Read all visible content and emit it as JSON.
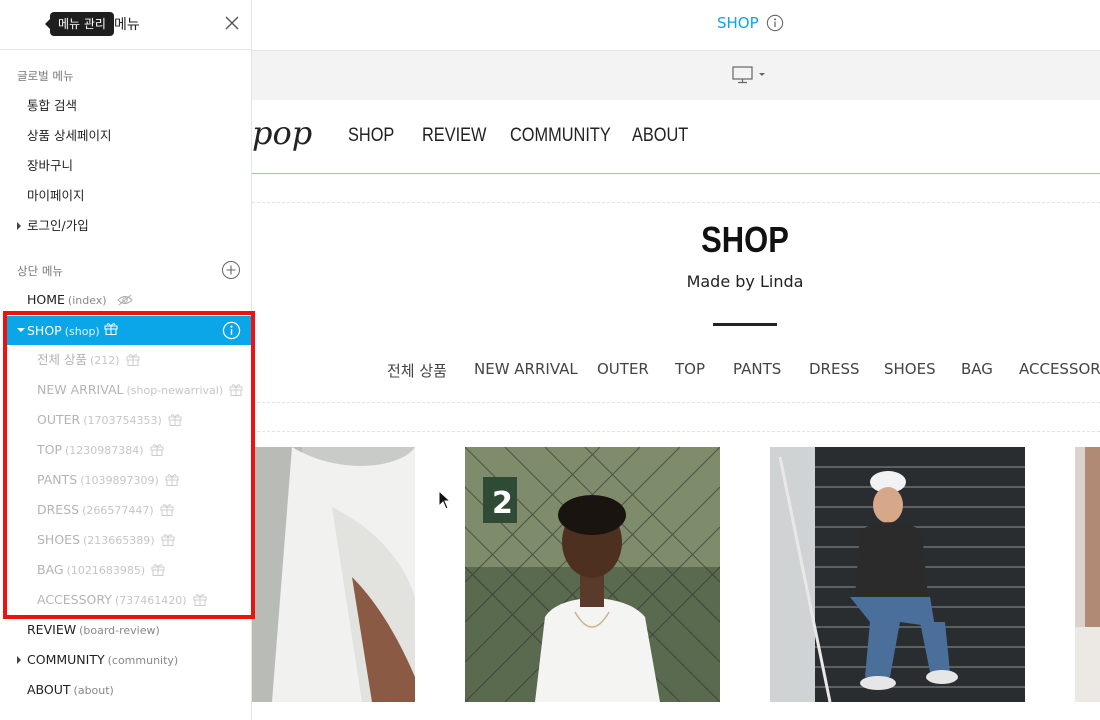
{
  "sidebar": {
    "tooltip": "메뉴 관리",
    "title": "메뉴",
    "global_label": "글로벌 메뉴",
    "global_items": [
      "통합 검색",
      "상품 상세페이지",
      "장바구니",
      "마이페이지",
      "로그인/가입"
    ],
    "top_label": "상단 메뉴",
    "home": {
      "label": "HOME",
      "slug": "(index)"
    },
    "shop": {
      "label": "SHOP",
      "slug": "(shop)"
    },
    "shop_children": [
      {
        "label": "전체 상품",
        "slug": "(212)"
      },
      {
        "label": "NEW ARRIVAL",
        "slug": "(shop-newarrival)"
      },
      {
        "label": "OUTER",
        "slug": "(1703754353)"
      },
      {
        "label": "TOP",
        "slug": "(1230987384)"
      },
      {
        "label": "PANTS",
        "slug": "(1039897309)"
      },
      {
        "label": "DRESS",
        "slug": "(266577447)"
      },
      {
        "label": "SHOES",
        "slug": "(213665389)"
      },
      {
        "label": "BAG",
        "slug": "(1021683985)"
      },
      {
        "label": "ACCESSORY",
        "slug": "(737461420)"
      }
    ],
    "review": {
      "label": "REVIEW",
      "slug": "(board-review)"
    },
    "community": {
      "label": "COMMUNITY",
      "slug": "(community)"
    },
    "about": {
      "label": "ABOUT",
      "slug": "(about)"
    }
  },
  "topbar": {
    "title": "SHOP"
  },
  "site": {
    "logo": "pop",
    "nav": [
      "SHOP",
      "REVIEW",
      "COMMUNITY",
      "ABOUT"
    ]
  },
  "page": {
    "heading": "SHOP",
    "subtitle": "Made by Linda",
    "categories": [
      "전체 상품",
      "NEW ARRIVAL",
      "OUTER",
      "TOP",
      "PANTS",
      "DRESS",
      "SHOES",
      "BAG",
      "ACCESSORY"
    ]
  },
  "colors": {
    "accent": "#0aa6e8",
    "highlight_border": "#ee1111"
  }
}
